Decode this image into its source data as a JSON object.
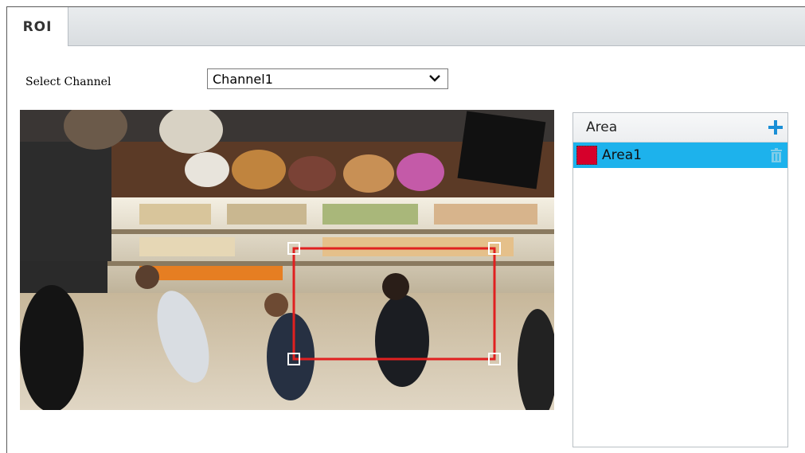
{
  "tabs": [
    {
      "label": "ROI"
    }
  ],
  "form": {
    "select_channel_label": "Select Channel",
    "channel_value": "Channel1"
  },
  "area_panel": {
    "header": "Area",
    "items": [
      {
        "label": "Area1",
        "color": "#d6002b"
      }
    ]
  },
  "colors": {
    "roi_rect": "#e02020",
    "selected_row": "#1db2ec",
    "add_icon": "#1a8fd6"
  }
}
